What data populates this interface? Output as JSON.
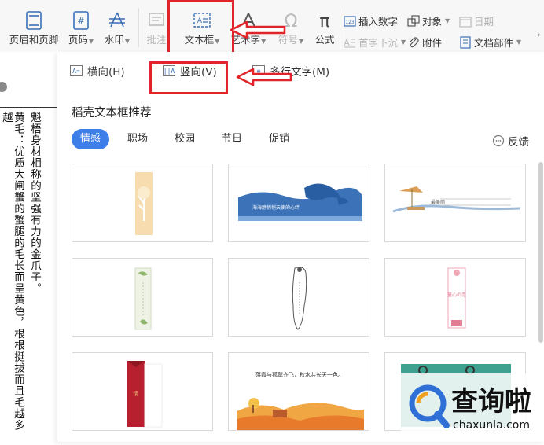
{
  "ribbon": {
    "header_footer": "页眉和页脚",
    "page_number": "页码",
    "watermark": "水印",
    "comment": "批注",
    "textbox": "文本框",
    "wordart": "艺术字",
    "symbol": "符号",
    "formula": "公式",
    "insert_number": "插入数字",
    "object": "对象",
    "date": "日期",
    "drop_cap": "首字下沉",
    "attachment": "附件",
    "doc_parts": "文档部件"
  },
  "dropdown": {
    "horizontal": "横向(H)",
    "vertical": "竖向(V)",
    "multiline": "多行文字(M)",
    "section_title": "稻壳文本框推荐",
    "tabs": [
      "情感",
      "职场",
      "校园",
      "节日",
      "促销"
    ],
    "active_tab": "情感",
    "feedback": "反馈",
    "templates": [
      {
        "kind": "tall-tree",
        "text": ""
      },
      {
        "kind": "dolphin-banner",
        "text": "海海静悄悄天使的心绊"
      },
      {
        "kind": "beach-banner",
        "text": "最美丽"
      },
      {
        "kind": "tall-leaves",
        "text": ""
      },
      {
        "kind": "tall-ornament",
        "text": ""
      },
      {
        "kind": "tall-pink",
        "text": "童心の恋"
      },
      {
        "kind": "red-bookmark",
        "text": "情"
      },
      {
        "kind": "autumn-landscape",
        "text": "落霞与孤鹜齐飞，秋水共长天一色。"
      },
      {
        "kind": "teal-card",
        "text": ""
      }
    ]
  },
  "document": {
    "col_right": "魁梧身材相称的坚强有力的金爪子。",
    "col_left": "黄毛：优质大闸蟹的蟹腿的毛长而呈黄色，根根挺拔而且毛越多越"
  },
  "watermark_logo": {
    "name": "查询啦",
    "url": "chaxunla.com"
  },
  "colors": {
    "accent": "#3e7ee8",
    "highlight": "#e0242a"
  }
}
